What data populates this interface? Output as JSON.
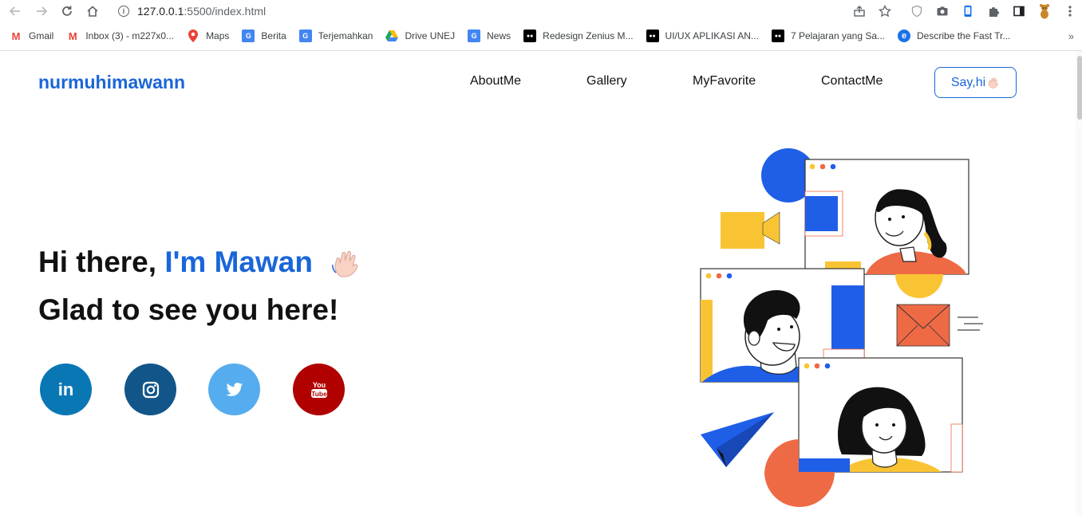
{
  "browser": {
    "url_host": "127.0.0.1",
    "url_path": ":5500/index.html",
    "bookmarks": [
      {
        "label": "Gmail",
        "icon": "gmail-icon",
        "color": "#ea4335"
      },
      {
        "label": "Inbox (3) - m227x0...",
        "icon": "gmail-icon",
        "color": "#ea4335"
      },
      {
        "label": "Maps",
        "icon": "maps-icon",
        "color": "#34a853"
      },
      {
        "label": "Berita",
        "icon": "news-icon",
        "color": "#4285f4"
      },
      {
        "label": "Terjemahkan",
        "icon": "translate-icon",
        "color": "#4285f4"
      },
      {
        "label": "Drive UNEJ",
        "icon": "drive-icon",
        "color": "#fbbc04"
      },
      {
        "label": "News",
        "icon": "news-icon",
        "color": "#4285f4"
      },
      {
        "label": "Redesign Zenius M...",
        "icon": "medium-icon",
        "color": "#000000"
      },
      {
        "label": "UI/UX APLIKASI AN...",
        "icon": "medium-icon",
        "color": "#000000"
      },
      {
        "label": "7 Pelajaran yang Sa...",
        "icon": "medium-icon",
        "color": "#000000"
      },
      {
        "label": "Describe the Fast Tr...",
        "icon": "edge-icon",
        "color": "#1a73e8"
      }
    ],
    "more": "»"
  },
  "site": {
    "logo": "nurmuhimawann",
    "menu": [
      "AboutMe",
      "Gallery",
      "MyFavorite",
      "ContactMe"
    ],
    "cta": "Say,hi",
    "hero_line1_prefix": "Hi there, ",
    "hero_line1_name": "I'm Mawan",
    "hero_line2": "Glad to see you here!",
    "accent": "#1a66d9",
    "social": [
      {
        "name": "linkedin-icon",
        "glyph": "in",
        "color": "#0a77b5"
      },
      {
        "name": "instagram-icon",
        "glyph": "",
        "color": "#125589"
      },
      {
        "name": "twitter-icon",
        "glyph": "",
        "color": "#55acee"
      },
      {
        "name": "youtube-icon",
        "glyph": "You Tube",
        "color": "#b00000"
      }
    ]
  }
}
